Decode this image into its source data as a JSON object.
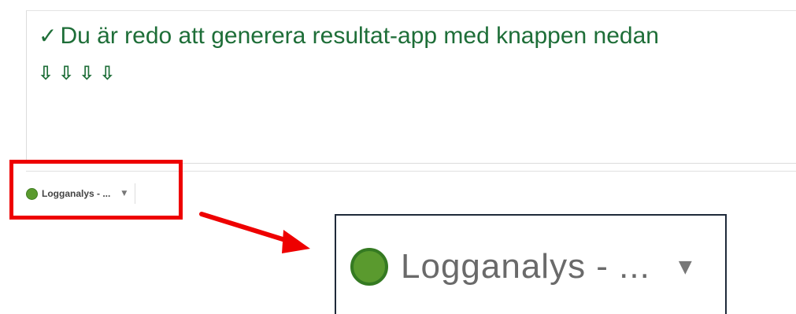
{
  "message": {
    "title": "Du är redo att generera resultat-app med knappen nedan",
    "check_glyph": "✓",
    "arrows": [
      "⇩",
      "⇩",
      "⇩",
      "⇩"
    ]
  },
  "status": {
    "label": "Logganalys - ...",
    "caret": "▼",
    "dot_color": "#5a9a2e"
  },
  "zoom": {
    "label": "Logganalys - ...",
    "caret": "▼"
  },
  "colors": {
    "message_text": "#1e6e38",
    "highlight": "#ee0000",
    "zoom_border": "#1f2a3a"
  },
  "icons": {
    "check": "check-icon",
    "arrow": "arrow-down-icon",
    "status": "status-dot-icon",
    "caret": "caret-down-icon"
  }
}
